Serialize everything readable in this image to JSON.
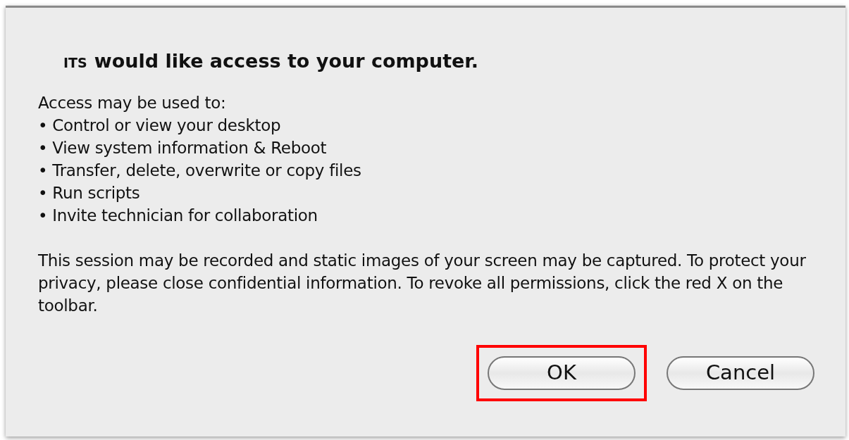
{
  "dialog": {
    "app_name": "ITS",
    "heading": "would like access to your computer.",
    "intro": "Access may be used to:",
    "bullets": [
      "• Control or view your desktop",
      "• View system information & Reboot",
      "• Transfer, delete, overwrite or copy files",
      "• Run scripts",
      "• Invite technician for collaboration"
    ],
    "notice": "This session may be recorded and static images of your screen may be captured. To protect your privacy, please close confidential information. To revoke all permissions, click the red X on the toolbar.",
    "buttons": [
      {
        "label": "OK",
        "highlighted": true
      },
      {
        "label": "Cancel",
        "highlighted": false
      }
    ]
  }
}
